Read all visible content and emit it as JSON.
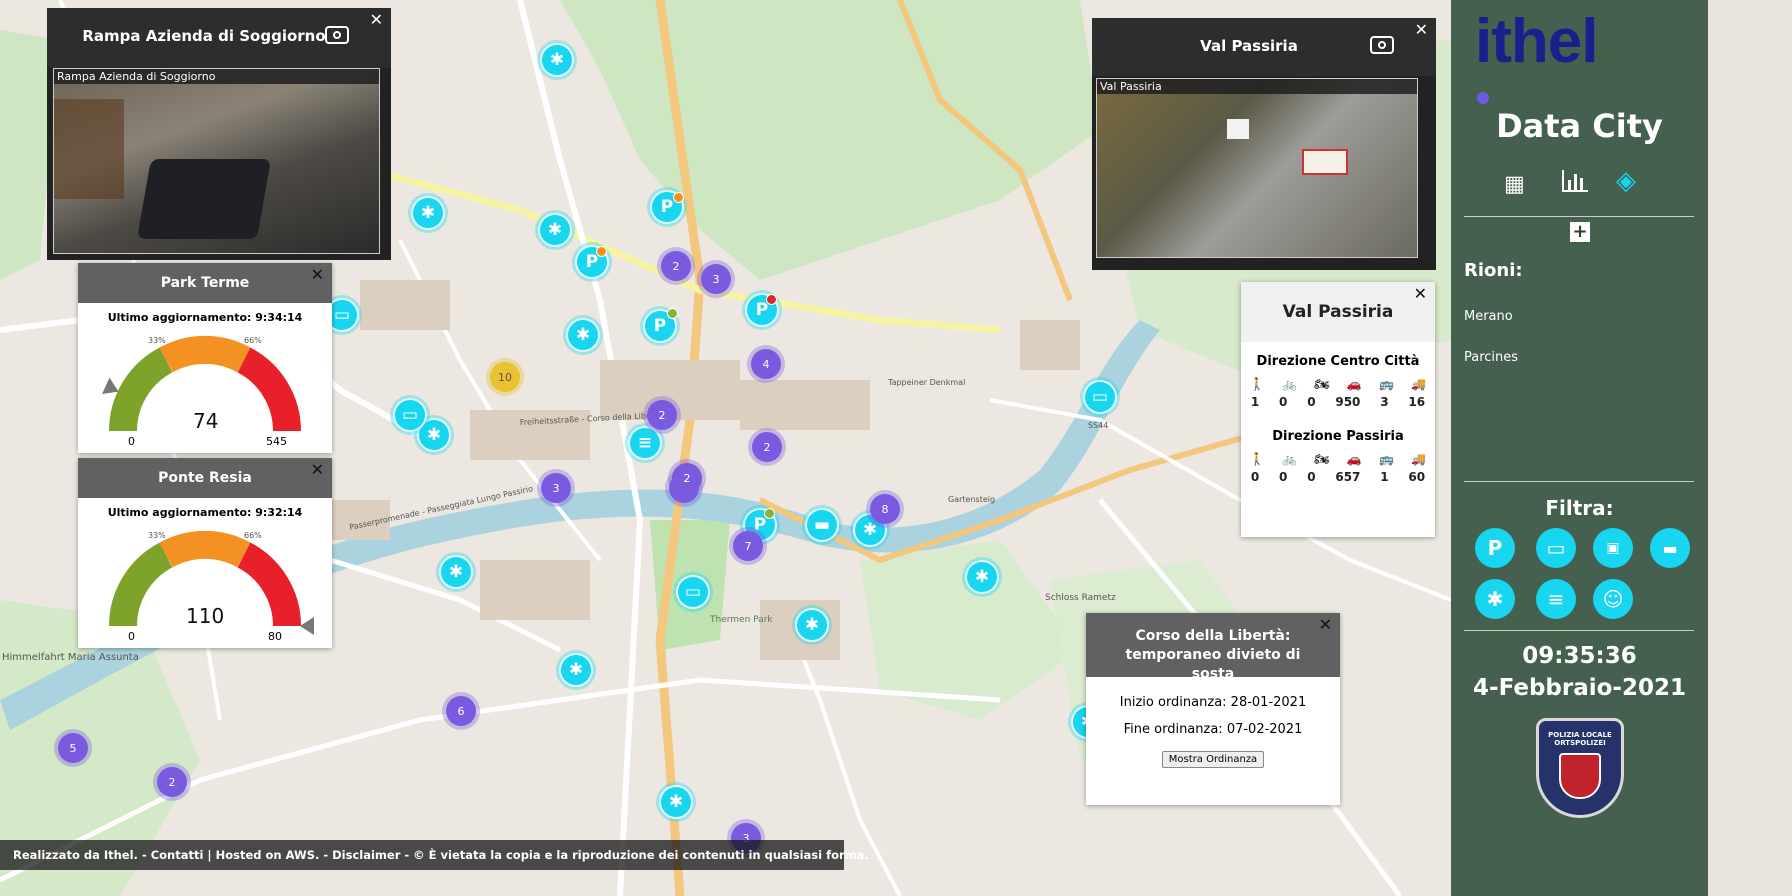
{
  "brand": {
    "logo": "ithel",
    "subtitle": "Data City",
    "accent": "#1a1f8c"
  },
  "sidebar": {
    "nav_icons": [
      "grid-icon",
      "bar-chart-icon",
      "map-icon"
    ],
    "rioni_title": "Rioni:",
    "rioni": [
      "Merano",
      "Parcines"
    ],
    "filter_title": "Filtra:",
    "filters": [
      "parking-icon",
      "camera-icon",
      "counter-icon",
      "sign-icon",
      "bluetooth-icon",
      "document-icon",
      "theater-icon"
    ],
    "time": "09:35:36",
    "date": "4-Febbraio-2021",
    "badge": {
      "line1": "POLIZIA LOCALE",
      "line2": "ORTSPOLIZEI"
    }
  },
  "cameras": {
    "rampa": {
      "title": "Rampa Azienda di Soggiorno",
      "overlay": "Rampa Azienda di Soggiorno"
    },
    "passiria": {
      "title": "Val Passiria",
      "overlay": "Val Passiria"
    }
  },
  "park_terme": {
    "title": "Park Terme",
    "updated": "Ultimo aggiornamento: 9:34:14",
    "value": "74",
    "min": "0",
    "max": "545",
    "t1": "33%",
    "t2": "66%",
    "level": 0.136
  },
  "ponte_resia": {
    "title": "Ponte Resia",
    "updated": "Ultimo aggiornamento: 9:32:14",
    "value": "110",
    "min": "0",
    "max": "80",
    "t1": "33%",
    "t2": "66%",
    "level": 1.0
  },
  "traffic": {
    "title": "Val Passiria",
    "dir1": {
      "title": "Direzione Centro Città",
      "values": [
        "1",
        "0",
        "0",
        "950",
        "3",
        "16"
      ]
    },
    "dir2": {
      "title": "Direzione Passiria",
      "values": [
        "0",
        "0",
        "0",
        "657",
        "1",
        "60"
      ]
    }
  },
  "ordinance": {
    "title": "Corso della Libertà: temporaneo divieto di sosta",
    "start": "Inizio ordinanza: 28-01-2021",
    "end": "Fine ordinanza: 07-02-2021",
    "button": "Mostra Ordinanza"
  },
  "footer": "Realizzato da Ithel. - Contatti | Hosted on AWS. - Disclaimer - © È vietata la copia e la riproduzione dei contenuti in qualsiasi forma.",
  "clusters": [
    "2",
    "3",
    "2",
    "10",
    "4",
    "2",
    "2",
    "3",
    "2",
    "8",
    "7",
    "6",
    "5",
    "2",
    "3"
  ],
  "map_labels": [
    "Freiheitsstraße - Corso della Libertà",
    "Passerpromenade - Passeggiata Lungo Passirio",
    "Thermen Park",
    "Schloss Rametz",
    "SS44",
    "Himmelfahrt Maria Assunta",
    "Gartensteig",
    "Tappeiner Denkmal"
  ]
}
